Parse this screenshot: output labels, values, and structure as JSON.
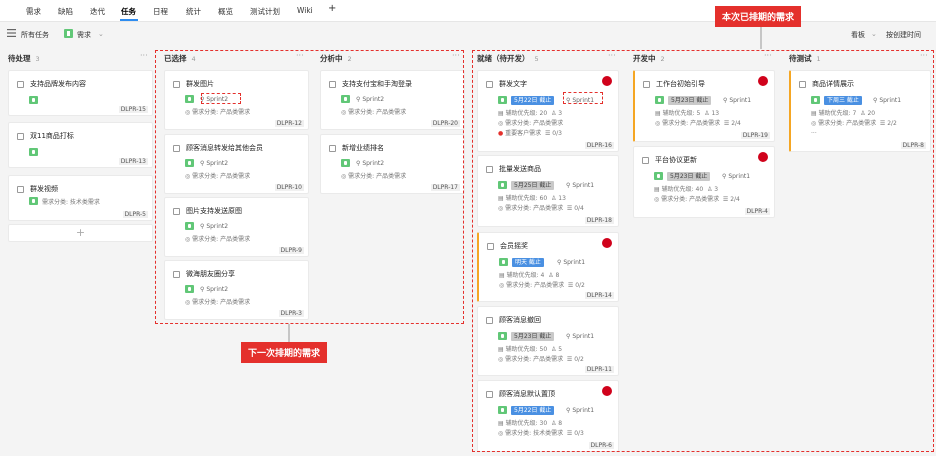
{
  "nav": {
    "tabs": [
      "需求",
      "缺陷",
      "迭代",
      "任务",
      "日程",
      "统计",
      "概览",
      "测试计划",
      "Wiki"
    ],
    "add": "+"
  },
  "toolbar": {
    "all_tasks": "所有任务",
    "type": "需求",
    "view": "看板",
    "sort": "按创建时间"
  },
  "annotations": {
    "current": "本次已排期的需求",
    "next": "下一次排期的需求"
  },
  "columns": [
    {
      "name": "待处理",
      "count": "3"
    },
    {
      "name": "已选择",
      "count": "4"
    },
    {
      "name": "分析中",
      "count": "2"
    },
    {
      "name": "就绪（待开发）",
      "count": "5"
    },
    {
      "name": "开发中",
      "count": "2"
    },
    {
      "name": "待测试",
      "count": "1"
    }
  ],
  "cards": {
    "p1": {
      "title": "支持品牌发布内容",
      "id": "DLPR-15"
    },
    "p2": {
      "title": "双11商品打标",
      "id": "DLPR-13"
    },
    "p3": {
      "title": "群发视频",
      "meta": "需求分类: 技术类需求",
      "id": "DLPR-5"
    },
    "s1": {
      "title": "群发图片",
      "sprint": "Sprint2",
      "meta": "需求分类: 产品类需求",
      "id": "DLPR-12"
    },
    "s2": {
      "title": "顾客消息转发给其他会员",
      "sprint": "Sprint2",
      "meta": "需求分类: 产品类需求",
      "id": "DLPR-10"
    },
    "s3": {
      "title": "图片支持发送原图",
      "sprint": "Sprint2",
      "meta": "需求分类: 产品类需求",
      "id": "DLPR-9"
    },
    "s4": {
      "title": "微海朋友圈分享",
      "sprint": "Sprint2",
      "meta": "需求分类: 产品类需求",
      "id": "DLPR-3"
    },
    "a1": {
      "title": "支持支付宝和手淘登录",
      "sprint": "Sprint2",
      "meta": "需求分类: 产品类需求",
      "id": "DLPR-20"
    },
    "a2": {
      "title": "新增业绩排名",
      "sprint": "Sprint2",
      "meta": "需求分类: 产品类需求",
      "id": "DLPR-17"
    },
    "r1": {
      "title": "群发文字",
      "date": "5月22日 截止",
      "sprint": "Sprint1",
      "m1": "辅助优先级: 20",
      "m1b": "3",
      "m2": "需求分类: 产品类需求",
      "m3": "重要客户需求",
      "m3b": "0/3",
      "id": "DLPR-16"
    },
    "r2": {
      "title": "批量发送商品",
      "date": "5月25日 截止",
      "sprint": "Sprint1",
      "m1": "辅助优先级: 60",
      "m1b": "13",
      "m2": "需求分类: 产品类需求",
      "m2b": "0/4",
      "id": "DLPR-18"
    },
    "r3": {
      "title": "会员摇奖",
      "date": "明天 截止",
      "sprint": "Sprint1",
      "m1": "辅助优先级: 4",
      "m1b": "8",
      "m2": "需求分类: 产品类需求",
      "m2b": "0/2",
      "id": "DLPR-14"
    },
    "r4": {
      "title": "顾客消息撤回",
      "date": "5月23日 截止",
      "sprint": "Sprint1",
      "m1": "辅助优先级: 50",
      "m1b": "5",
      "m2": "需求分类: 产品类需求",
      "m2b": "0/2",
      "id": "DLPR-11"
    },
    "r5": {
      "title": "顾客消息默认置顶",
      "date": "5月22日 截止",
      "sprint": "Sprint1",
      "m1": "辅助优先级: 30",
      "m1b": "8",
      "m2": "需求分类: 技术类需求",
      "m2b": "0/3",
      "id": "DLPR-6"
    },
    "d1": {
      "title": "工作台初始引导",
      "date": "5月23日 截止",
      "sprint": "Sprint1",
      "m1": "辅助优先级: 5",
      "m1b": "13",
      "m2": "需求分类: 产品类需求",
      "m2b": "2/4",
      "id": "DLPR-19"
    },
    "d2": {
      "title": "平台协议更新",
      "date": "5月23日 截止",
      "sprint": "Sprint1",
      "m1": "辅助优先级: 40",
      "m1b": "3",
      "m2": "需求分类: 产品类需求",
      "m2b": "2/4",
      "id": "DLPR-4"
    },
    "t1": {
      "title": "商品详情展示",
      "date": "下周三 截止",
      "sprint": "Sprint1",
      "m1": "辅助优先级: 7",
      "m1b": "20",
      "m2": "需求分类: 产品类需求",
      "m2b": "2/2",
      "m3": "...",
      "id": "DLPR-8"
    }
  },
  "add_card": "+"
}
